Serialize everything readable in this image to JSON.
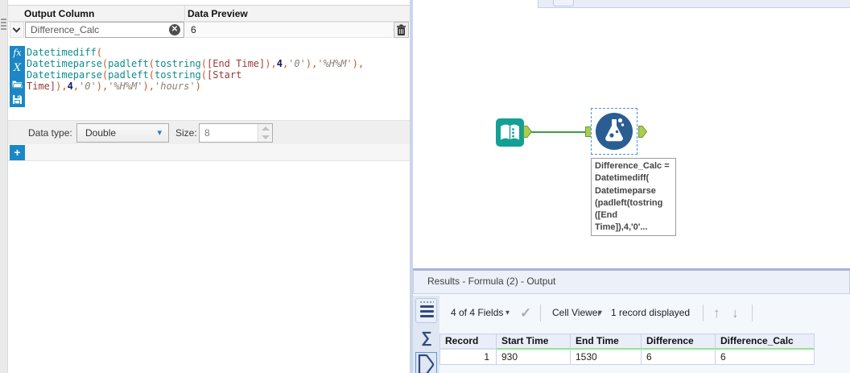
{
  "config": {
    "header": {
      "output_column": "Output Column",
      "data_preview": "Data Preview"
    },
    "expression_row": {
      "output_column_value": "Difference_Calc",
      "clear_glyph": "✕",
      "data_preview_value": "6"
    },
    "editor_icons": {
      "fx": "fx",
      "variables": "X"
    },
    "formula_lines": [
      [
        [
          "fn",
          "Datetimediff"
        ],
        [
          "p",
          "("
        ]
      ],
      [
        [
          "fn",
          "Datetimeparse"
        ],
        [
          "p",
          "("
        ],
        [
          "fn",
          "padleft"
        ],
        [
          "p",
          "("
        ],
        [
          "fn",
          "tostring"
        ],
        [
          "p",
          "("
        ],
        [
          "fld",
          "[End Time]"
        ],
        [
          "p",
          "),"
        ],
        [
          "num",
          "4"
        ],
        [
          "p",
          ","
        ],
        [
          "str",
          "'0'"
        ],
        [
          "p",
          "),"
        ],
        [
          "str",
          "'%H%M'"
        ],
        [
          "p",
          "),"
        ]
      ],
      [
        [
          "fn",
          "Datetimeparse"
        ],
        [
          "p",
          "("
        ],
        [
          "fn",
          "padleft"
        ],
        [
          "p",
          "("
        ],
        [
          "fn",
          "tostring"
        ],
        [
          "p",
          "("
        ],
        [
          "fld",
          "[Start"
        ]
      ],
      [
        [
          "fld",
          "Time]"
        ],
        [
          "p",
          "),"
        ],
        [
          "num",
          "4"
        ],
        [
          "p",
          ","
        ],
        [
          "str",
          "'0'"
        ],
        [
          "p",
          "),"
        ],
        [
          "str",
          "'%H%M'"
        ],
        [
          "p",
          "),"
        ],
        [
          "str",
          "'hours'"
        ],
        [
          "p",
          ")"
        ]
      ]
    ],
    "data_type": {
      "label": "Data type:",
      "value": "Double",
      "caret": "▾",
      "size_label": "Size:",
      "size_value": "8"
    },
    "add_label": "+"
  },
  "canvas": {
    "annotation_lines": [
      "Difference_Calc =",
      "Datetimediff(",
      "Datetimeparse",
      "(padleft(tostring",
      "([End",
      "Time]),4,'0'..."
    ]
  },
  "results": {
    "title": "Results - Formula (2) - Output",
    "toolbar": {
      "fields": "4 of 4 Fields",
      "caret": "▾",
      "check": "✓",
      "cell_viewer": "Cell Viewer",
      "records": "1 record displayed",
      "up": "↑",
      "down": "↓"
    },
    "sigma_glyph": "∑",
    "table": {
      "columns": [
        "Record",
        "Start Time",
        "End Time",
        "Difference",
        "Difference_Calc"
      ],
      "rows": [
        [
          "1",
          "930",
          "1530",
          "6",
          "6"
        ]
      ]
    }
  },
  "colors": {
    "accent_blue": "#1B87C5",
    "tool_teal": "#13A095",
    "formula_blue": "#2A5E93",
    "wire_green": "#3E9E41",
    "anchor_green": "#AACD52",
    "header_green_underline": "#8FE78F"
  }
}
